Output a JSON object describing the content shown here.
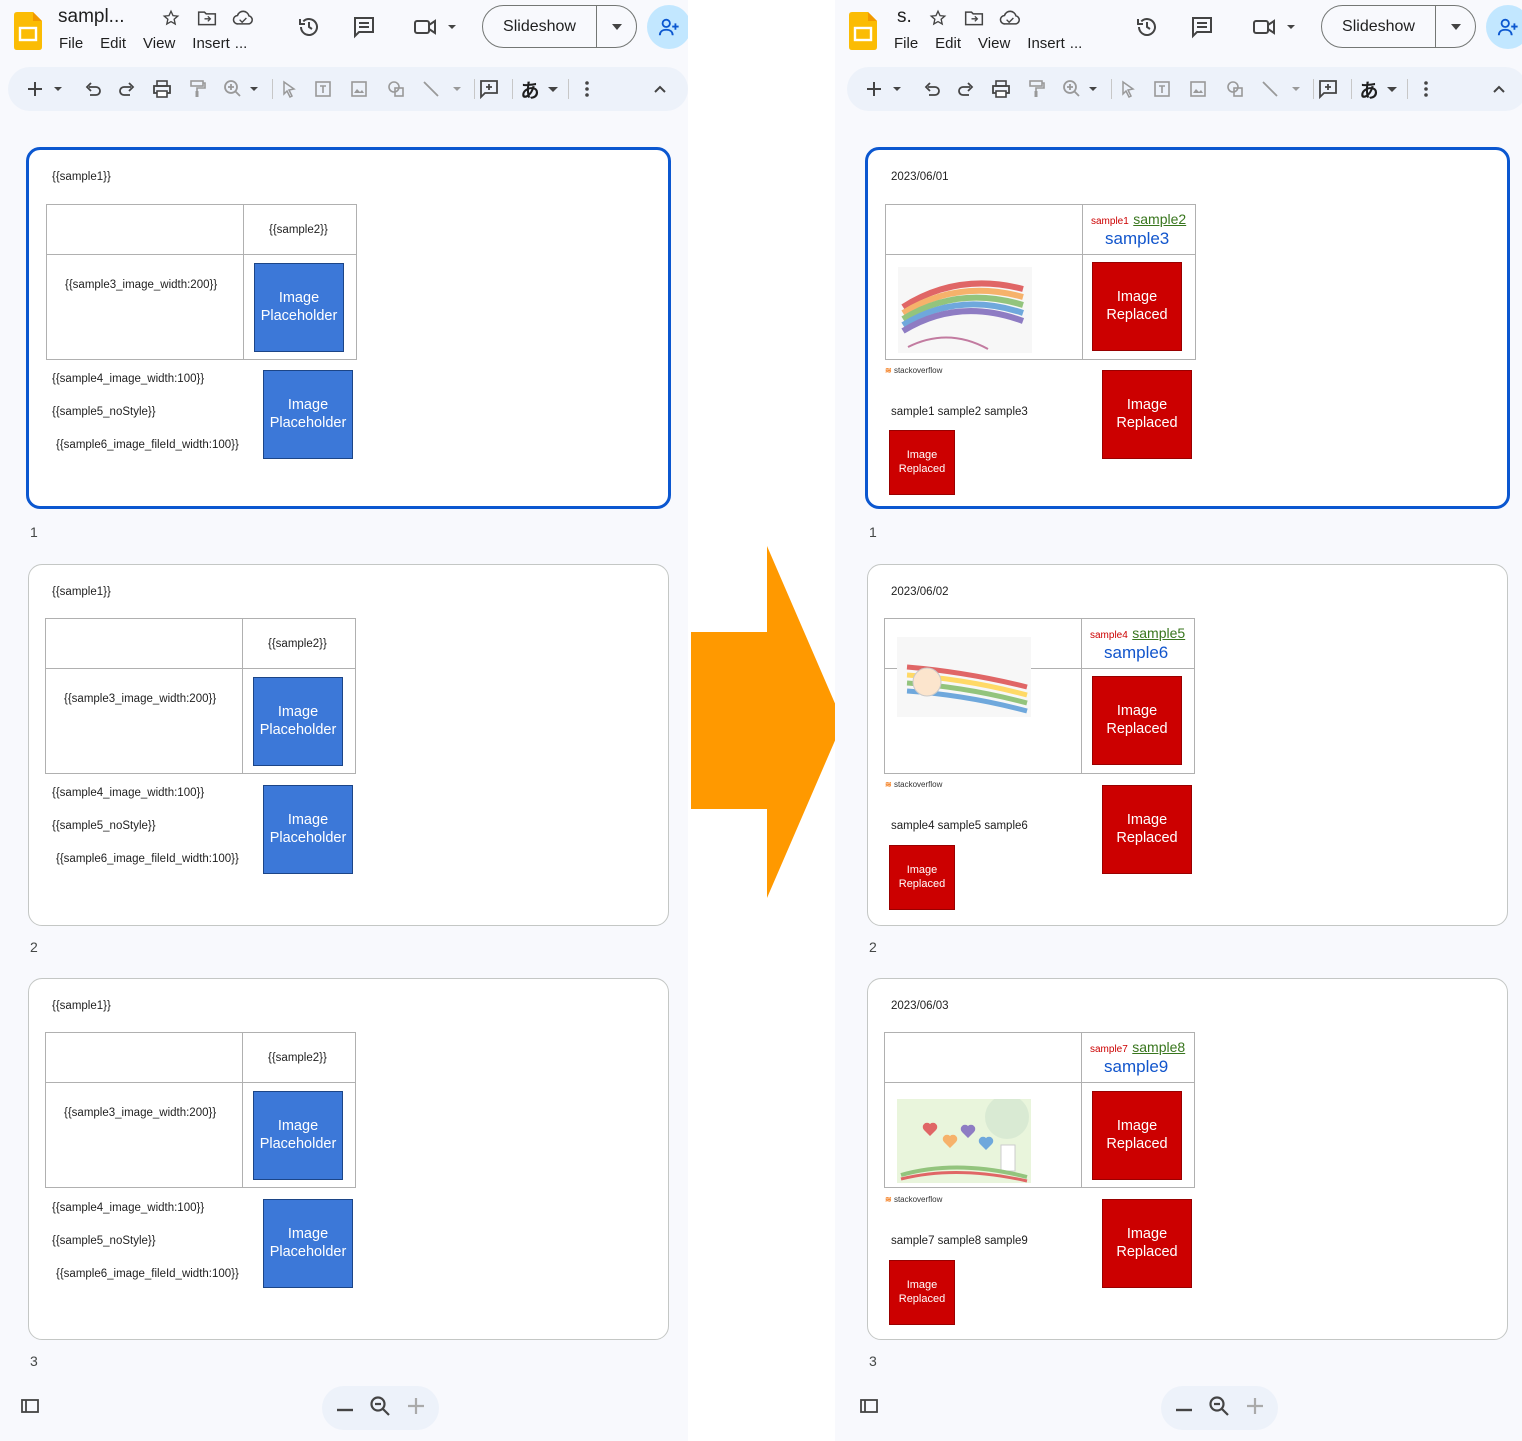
{
  "left": {
    "doc_title": "sampl...",
    "menu": [
      "File",
      "Edit",
      "View",
      "Insert",
      "..."
    ],
    "slideshow_label": "Slideshow",
    "slides": [
      {
        "num": "1",
        "title_tag": "{{sample1}}",
        "header_tag": "{{sample2}}",
        "cell_tag": "{{sample3_image_width:200}}",
        "image_label": "Image\nPlaceholder",
        "line1": "{{sample4_image_width:100}}",
        "line2": "{{sample5_noStyle}}",
        "line3": "{{sample6_image_fileId_width:100}}",
        "image2_label": "Image\nPlaceholder"
      },
      {
        "num": "2",
        "title_tag": "{{sample1}}",
        "header_tag": "{{sample2}}",
        "cell_tag": "{{sample3_image_width:200}}",
        "image_label": "Image\nPlaceholder",
        "line1": "{{sample4_image_width:100}}",
        "line2": "{{sample5_noStyle}}",
        "line3": "{{sample6_image_fileId_width:100}}",
        "image2_label": "Image\nPlaceholder"
      },
      {
        "num": "3",
        "title_tag": "{{sample1}}",
        "header_tag": "{{sample2}}",
        "cell_tag": "{{sample3_image_width:200}}",
        "image_label": "Image\nPlaceholder",
        "line1": "{{sample4_image_width:100}}",
        "line2": "{{sample5_noStyle}}",
        "line3": "{{sample6_image_fileId_width:100}}",
        "image2_label": "Image\nPlaceholder"
      }
    ]
  },
  "right": {
    "doc_title": "s.",
    "menu": [
      "File",
      "Edit",
      "View",
      "Insert",
      "..."
    ],
    "slideshow_label": "Slideshow",
    "slides": [
      {
        "num": "1",
        "date": "2023/06/01",
        "small_red": "sample1",
        "green_link": "sample2",
        "blue_big": "sample3",
        "image_label": "Image\nReplaced",
        "logo_text": "stackoverflow",
        "combined": "sample1 sample2 sample3",
        "image2_label": "Image\nReplaced",
        "image3_label": "Image\nReplaced"
      },
      {
        "num": "2",
        "date": "2023/06/02",
        "small_red": "sample4",
        "green_link": "sample5",
        "blue_big": "sample6",
        "image_label": "Image\nReplaced",
        "logo_text": "stackoverflow",
        "combined": "sample4 sample5 sample6",
        "image2_label": "Image\nReplaced",
        "image3_label": "Image\nReplaced"
      },
      {
        "num": "3",
        "date": "2023/06/03",
        "small_red": "sample7",
        "green_link": "sample8",
        "blue_big": "sample9",
        "image_label": "Image\nReplaced",
        "logo_text": "stackoverflow",
        "combined": "sample7 sample8 sample9",
        "image2_label": "Image\nReplaced",
        "image3_label": "Image\nReplaced"
      }
    ]
  },
  "colors": {
    "placeholder_blue": "#3c78d8",
    "replaced_red": "#cc0000",
    "arrow_orange": "#ff9900",
    "selection_blue": "#0b57d0"
  }
}
